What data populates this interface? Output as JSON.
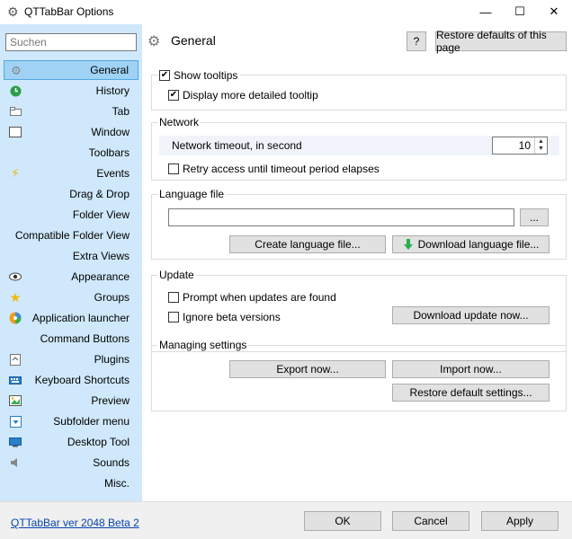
{
  "window": {
    "title": "QTTabBar Options",
    "minimize_glyph": "—",
    "maximize_glyph": "☐",
    "close_glyph": "✕"
  },
  "sidebar": {
    "search_placeholder": "Suchen",
    "items": [
      {
        "label": "General",
        "icon": "gear-icon",
        "selected": true
      },
      {
        "label": "History",
        "icon": "history-icon"
      },
      {
        "label": "Tab",
        "icon": "tab-icon"
      },
      {
        "label": "Window",
        "icon": "window-icon"
      },
      {
        "label": "Toolbars",
        "icon": ""
      },
      {
        "label": "Events",
        "icon": "lightning-icon"
      },
      {
        "label": "Drag & Drop",
        "icon": ""
      },
      {
        "label": "Folder View",
        "icon": ""
      },
      {
        "label": "Compatible Folder View",
        "icon": ""
      },
      {
        "label": "Extra Views",
        "icon": ""
      },
      {
        "label": "Appearance",
        "icon": "eye-icon"
      },
      {
        "label": "Groups",
        "icon": "star-icon"
      },
      {
        "label": "Application launcher",
        "icon": "launcher-icon"
      },
      {
        "label": "Command Buttons",
        "icon": ""
      },
      {
        "label": "Plugins",
        "icon": "plugin-icon"
      },
      {
        "label": "Keyboard Shortcuts",
        "icon": "keyboard-icon"
      },
      {
        "label": "Preview",
        "icon": "preview-icon"
      },
      {
        "label": "Subfolder menu",
        "icon": "subfolder-icon"
      },
      {
        "label": "Desktop Tool",
        "icon": "desktop-icon"
      },
      {
        "label": "Sounds",
        "icon": "speaker-icon"
      },
      {
        "label": "Misc.",
        "icon": ""
      }
    ]
  },
  "main": {
    "page_title": "General",
    "help_label": "?",
    "restore_page_label": "Restore defaults of this page",
    "tooltips": {
      "show_tooltips": "Show tooltips",
      "show_tooltips_checked": true,
      "detailed_tooltip": "Display more detailed tooltip",
      "detailed_tooltip_checked": true
    },
    "network": {
      "title": "Network",
      "timeout_label": "Network timeout, in second",
      "timeout_value": "10",
      "retry_label": "Retry access until timeout period elapses",
      "retry_checked": false
    },
    "language": {
      "title": "Language file",
      "file_value": "",
      "browse_label": "...",
      "create_label": "Create language file...",
      "download_label": "Download language file..."
    },
    "update": {
      "title": "Update",
      "prompt_label": "Prompt when updates are found",
      "ignore_beta_label": "Ignore beta versions",
      "download_update_label": "Download update now..."
    },
    "managing": {
      "title": "Managing settings",
      "export_label": "Export now...",
      "import_label": "Import now...",
      "restore_defaults_label": "Restore default settings..."
    }
  },
  "footer": {
    "version_label": "QTTabBar ver 2048 Beta 2",
    "ok_label": "OK",
    "cancel_label": "Cancel",
    "apply_label": "Apply"
  },
  "colors": {
    "sidebar_bg": "#cfe8fb",
    "selected_bg": "#9fd2f5",
    "link": "#0645ad",
    "download_arrow": "#22b14c"
  }
}
